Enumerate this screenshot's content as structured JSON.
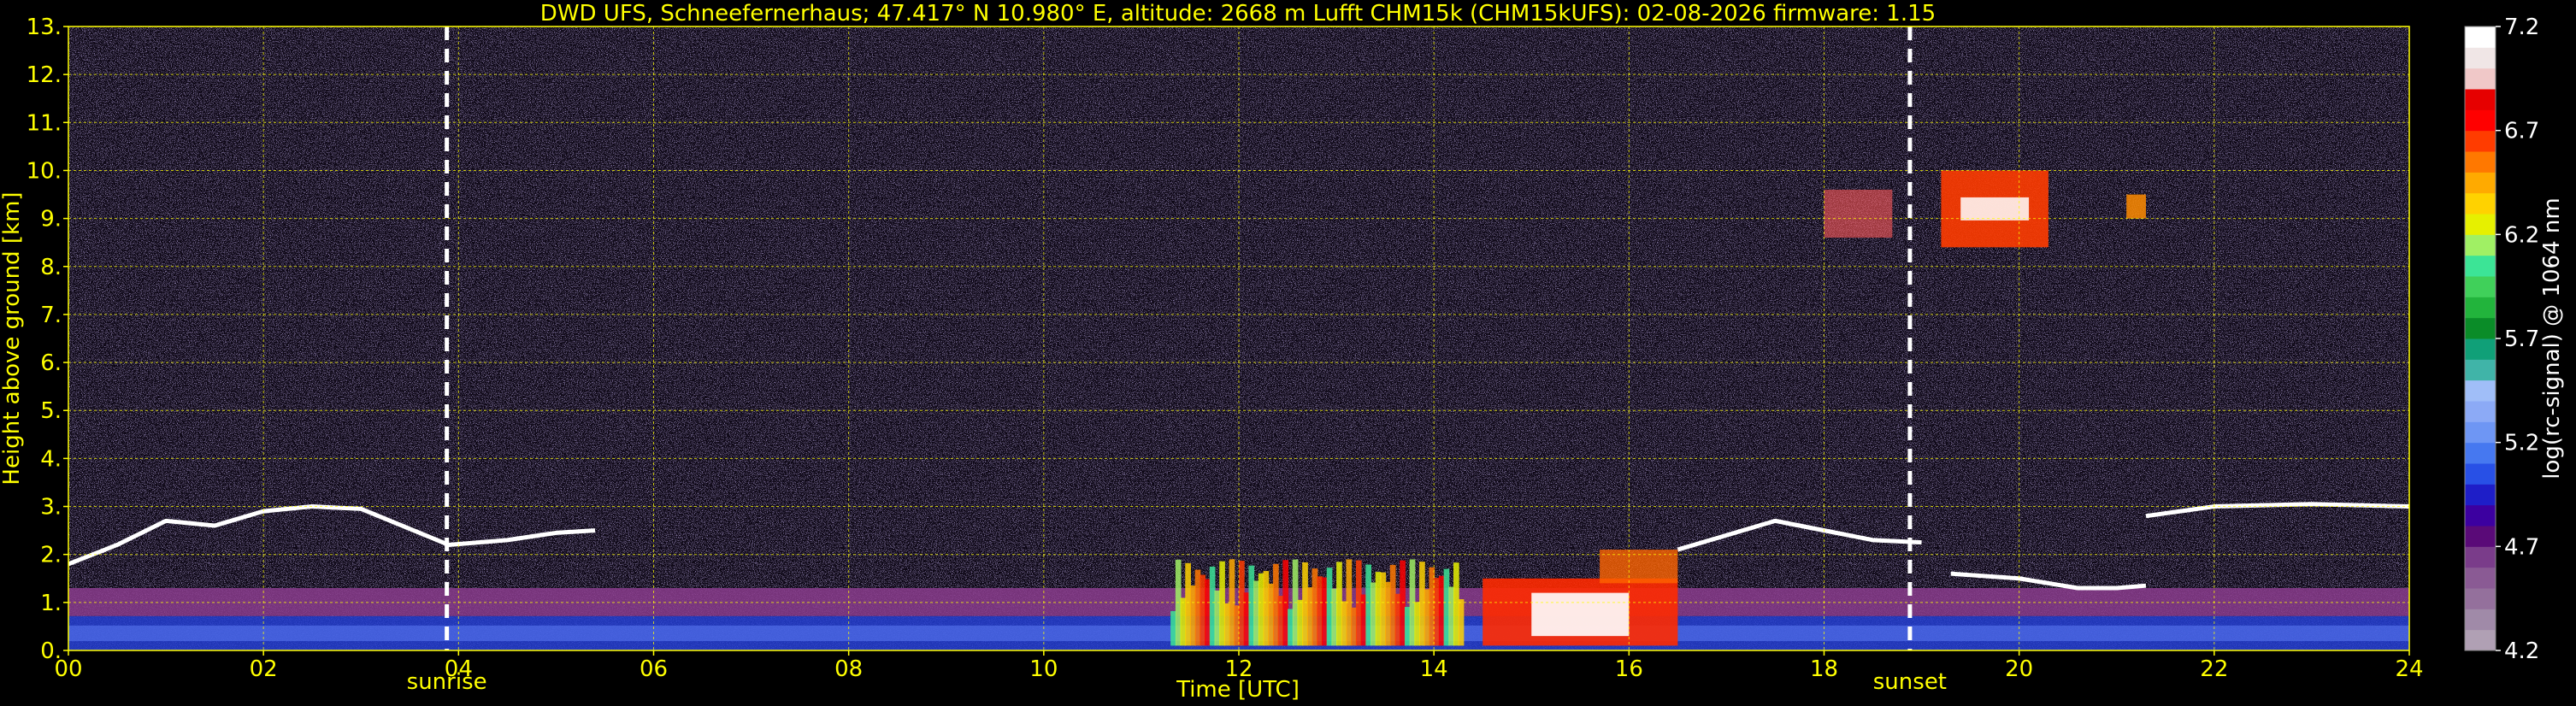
{
  "chart_data": {
    "type": "heatmap",
    "title": "DWD UFS, Schneefernerhaus; 47.417° N 10.980° E, altitude: 2668 m    Lufft CHM15k (CHM15kUFS): 02-08-2026    firmware: 1.15",
    "xlabel": "Time [UTC]",
    "ylabel": "Height above ground [km]",
    "xlim": [
      0,
      24
    ],
    "ylim": [
      0,
      13
    ],
    "x_ticks": [
      "00",
      "02",
      "04",
      "06",
      "08",
      "10",
      "12",
      "14",
      "16",
      "18",
      "20",
      "22",
      "24"
    ],
    "y_ticks": [
      "0.",
      "1.",
      "2.",
      "3.",
      "4.",
      "5.",
      "6.",
      "7.",
      "8.",
      "9.",
      "10.",
      "11.",
      "12.",
      "13."
    ],
    "grid": true,
    "colorbar": {
      "label": "log(rc-signal) @ 1064 nm",
      "range": [
        4.2,
        7.2
      ],
      "ticks": [
        "4.2",
        "4.7",
        "5.2",
        "5.7",
        "6.2",
        "6.7",
        "7.2"
      ],
      "colors": [
        "#b0a0b4",
        "#a08aa8",
        "#94709c",
        "#8a5a94",
        "#7a3c8a",
        "#5a0a78",
        "#3c00a0",
        "#1e1ec8",
        "#2850e6",
        "#4678f0",
        "#6e96f4",
        "#8caaf6",
        "#a0bef8",
        "#40b4a8",
        "#10a078",
        "#0a8c28",
        "#22b43c",
        "#40d05a",
        "#3ce496",
        "#a0f064",
        "#e6f000",
        "#ffd200",
        "#ffaa00",
        "#ff7800",
        "#ff3c00",
        "#ff0000",
        "#e60000",
        "#f0c8c8",
        "#f0e6e6",
        "#ffffff"
      ]
    },
    "events": [
      {
        "label": "sunrise",
        "time": 3.88
      },
      {
        "label": "sunset",
        "time": 18.88
      }
    ],
    "axis_color": "#ffff00",
    "grid_color": "#ffff00",
    "features": [
      {
        "desc": "boundary_layer_aerosol",
        "t_start": 0,
        "t_end": 24,
        "h_bottom": 0,
        "h_top": 1.3
      },
      {
        "desc": "cloud_base",
        "times": [
          0,
          0.5,
          1,
          1.5,
          2,
          2.5,
          3,
          3.9,
          4.5,
          5,
          5.4
        ],
        "heights": [
          1.8,
          2.2,
          2.7,
          2.6,
          2.9,
          3.0,
          2.95,
          2.2,
          2.3,
          2.45,
          2.5
        ]
      },
      {
        "desc": "convective_echo",
        "t_start": 11.3,
        "t_end": 14.3,
        "h_bottom": 0.1,
        "h_top": 1.9
      },
      {
        "desc": "low_cloud",
        "t_start": 14.5,
        "t_end": 16.5,
        "h_bottom": 0.1,
        "h_top": 2.1
      },
      {
        "desc": "cloud_base",
        "times": [
          16.5,
          17,
          17.5,
          18,
          18.5,
          19
        ],
        "heights": [
          2.1,
          2.4,
          2.7,
          2.5,
          2.3,
          2.25
        ]
      },
      {
        "desc": "cirrus",
        "t_start": 18.0,
        "t_end": 21.3,
        "h_bottom": 8.4,
        "h_top": 10.0
      },
      {
        "desc": "cloud_base",
        "times": [
          19.3,
          20,
          20.6,
          21,
          21.3
        ],
        "heights": [
          1.6,
          1.5,
          1.3,
          1.3,
          1.35
        ]
      },
      {
        "desc": "cloud_base",
        "times": [
          21.3,
          22,
          23,
          24
        ],
        "heights": [
          2.8,
          3.0,
          3.05,
          3.0
        ]
      }
    ]
  }
}
